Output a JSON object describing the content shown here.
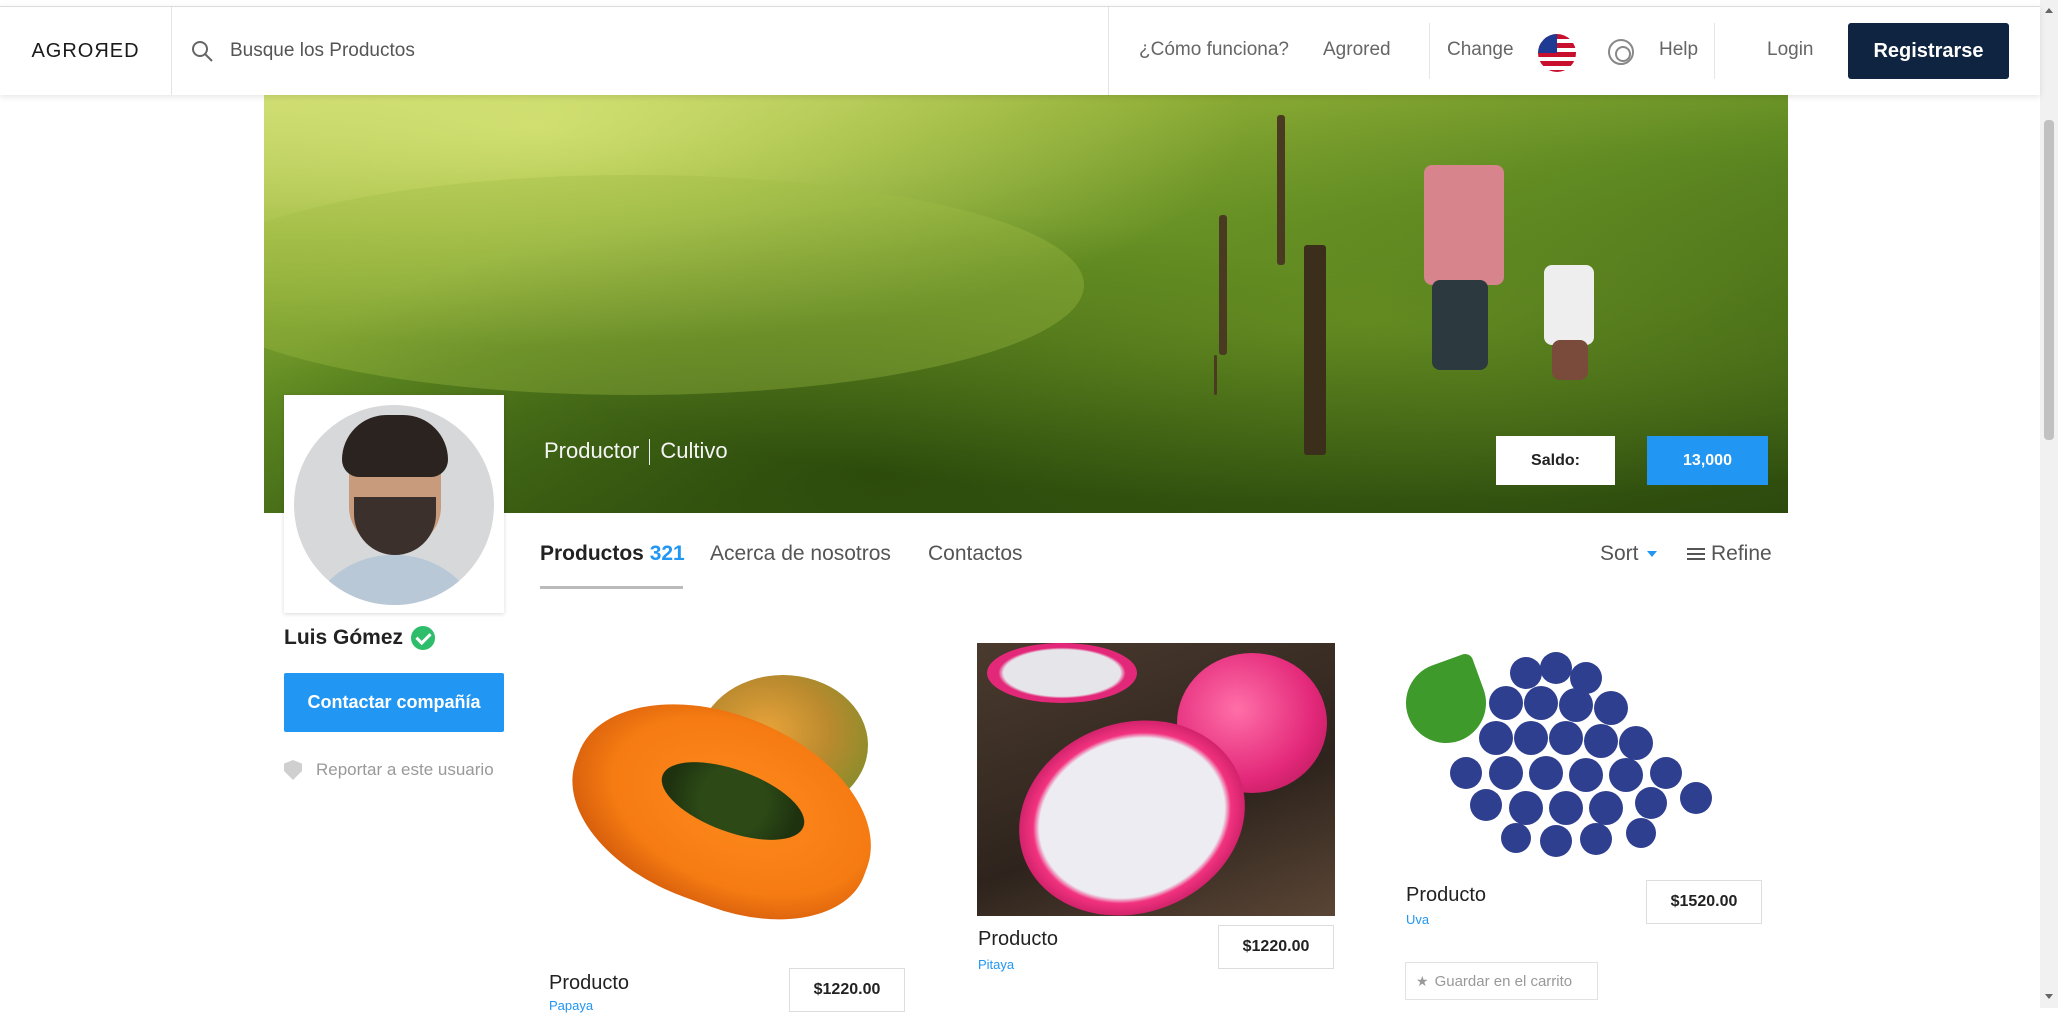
{
  "nav": {
    "logo": "AGROЯED",
    "search_placeholder": "Busque los Productos",
    "how_it_works": "¿Cómo funciona?",
    "agrored": "Agrored",
    "change": "Change",
    "help": "Help",
    "login": "Login",
    "register": "Registrarse"
  },
  "hero": {
    "role": "Productor",
    "category": "Cultivo",
    "balance_label": "Saldo:",
    "balance_value": "13,000"
  },
  "profile": {
    "name": "Luis Gómez",
    "contact_button": "Contactar compañía",
    "report": "Reportar a este usuario"
  },
  "tabs": {
    "products_label": "Productos",
    "products_count": "321",
    "about": "Acerca de nosotros",
    "contacts": "Contactos",
    "sort": "Sort",
    "refine": "Refine"
  },
  "products": [
    {
      "title": "Producto",
      "subtitle": "Papaya",
      "price": "$1220.00"
    },
    {
      "title": "Producto",
      "subtitle": "Pitaya",
      "price": "$1220.00"
    },
    {
      "title": "Producto",
      "subtitle": "Uva",
      "price": "$1520.00",
      "cart": "Guardar en el carrito"
    }
  ],
  "colors": {
    "accent": "#2196f3",
    "navy": "#0f2440",
    "verified": "#2ebd6b"
  }
}
